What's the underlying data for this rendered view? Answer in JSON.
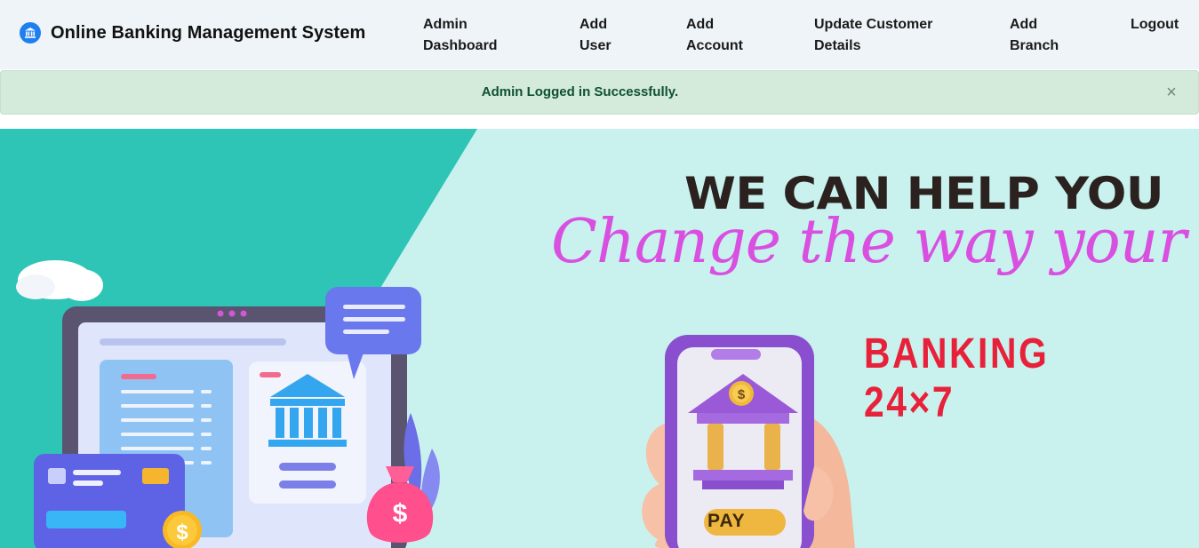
{
  "navbar": {
    "brand_title": "Online Banking Management System",
    "brand_icon": "bank-icon",
    "links": [
      {
        "line1": "Admin",
        "line2": "Dashboard"
      },
      {
        "line1": "Add",
        "line2": "User"
      },
      {
        "line1": "Add",
        "line2": "Account"
      },
      {
        "line1": "Update Customer",
        "line2": "Details"
      },
      {
        "line1": "Add",
        "line2": "Branch"
      },
      {
        "line1": "Logout",
        "line2": ""
      }
    ]
  },
  "alert": {
    "message": "Admin Logged in Successfully.",
    "close_symbol": "×",
    "close_icon": "close-icon"
  },
  "banner": {
    "headline": "WE CAN HELP YOU",
    "tagline": "Change the way your bank",
    "banking": "BANKING 24×7",
    "pay_label": "PAY",
    "coin_symbol": "$"
  },
  "colors": {
    "navbar_bg": "#eef4f8",
    "alert_bg": "#d4eadb",
    "alert_text": "#0f5132",
    "banner_bg": "#c9f2ee",
    "banner_teal": "#2ec5b6",
    "brand_icon_bg": "#1f7ff0",
    "headline": "#2b2220",
    "tagline": "#d94fe0",
    "banking": "#e8213a"
  }
}
